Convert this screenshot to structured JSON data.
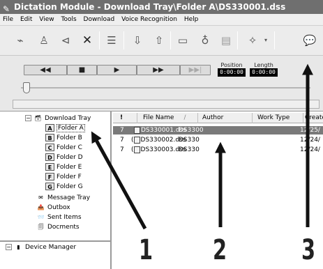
{
  "window": {
    "title": "Dictation Module - Download Tray\\Folder A\\DS330001.dss"
  },
  "menu": [
    "File",
    "Edit",
    "View",
    "Tools",
    "Download",
    "Voice Recognition",
    "Help"
  ],
  "toolbar": {
    "icons": [
      "record-icon",
      "play-icon",
      "back-icon",
      "delete-icon",
      "properties-icon",
      "send-icon",
      "receive-icon",
      "folder-icon",
      "microphone-icon",
      "document-icon",
      "settings-icon",
      "dropdown-icon",
      "comment-icon"
    ]
  },
  "transport": {
    "rewind": "◀◀",
    "stop": "■",
    "play": "▶",
    "fast_forward": "▶▶",
    "skip": "▶▶|",
    "position_label": "Position",
    "position_value": "0:00:00",
    "length_label": "Length",
    "length_value": "0:00:00"
  },
  "tree": {
    "download_tray": "Download Tray",
    "folders": [
      {
        "letter": "A",
        "label": "Folder A"
      },
      {
        "letter": "B",
        "label": "Folder B"
      },
      {
        "letter": "C",
        "label": "Folder C"
      },
      {
        "letter": "D",
        "label": "Folder D"
      },
      {
        "letter": "E",
        "label": "Folder E"
      },
      {
        "letter": "F",
        "label": "Folder F"
      },
      {
        "letter": "G",
        "label": "Folder G"
      }
    ],
    "message_tray": "Message Tray",
    "outbox": "Outbox",
    "sent_items": "Sent Items",
    "documents": "Docments",
    "device_manager": "Device Manager"
  },
  "list": {
    "columns": [
      "!",
      "File Name",
      "Author",
      "Work Type",
      "Create"
    ],
    "sort_indicator": "/",
    "rows": [
      {
        "priority": "7",
        "prefix": "",
        "file": "DS330001.dss",
        "author": "DS3300",
        "created": "12/25/"
      },
      {
        "priority": "7",
        "prefix": "(",
        "file": "DS330002.dss",
        "author": "DS330",
        "created": "12/24/"
      },
      {
        "priority": "7",
        "prefix": "(",
        "file": "DS330003.dss",
        "author": "DS330",
        "created": "12/24/"
      }
    ]
  },
  "callouts": [
    "1",
    "2",
    "3"
  ],
  "colors": {
    "titlebar": "#6f6f6f",
    "selection": "#7a7a7a",
    "arrow": "#111111"
  }
}
